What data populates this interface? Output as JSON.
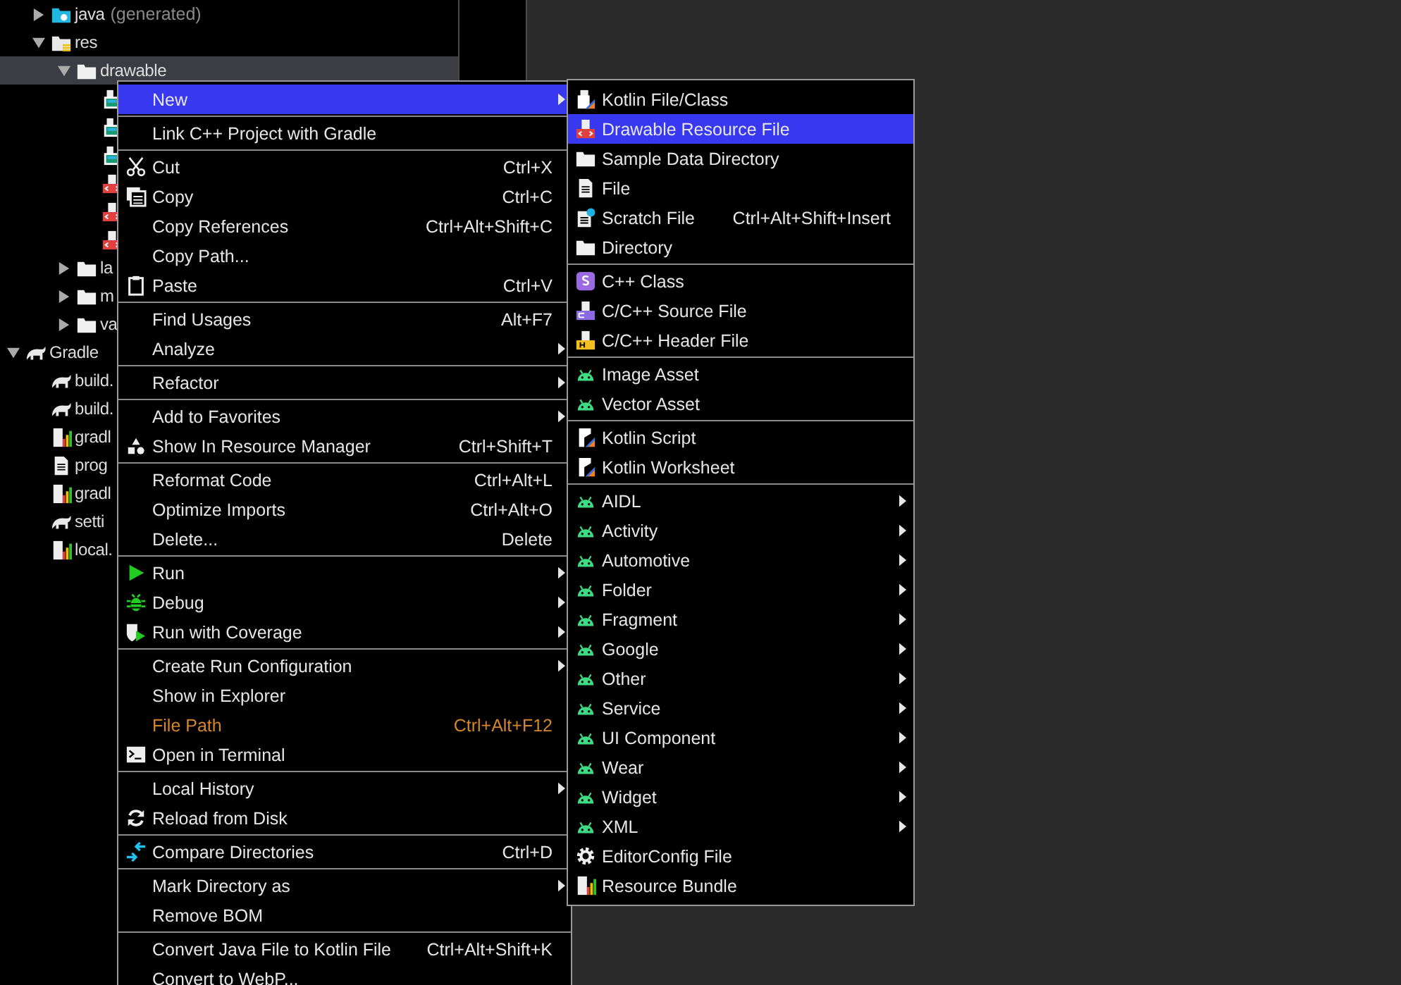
{
  "project_tree": {
    "module_items": [
      {
        "label": "java",
        "note": "(generated)",
        "kind": "java-folder",
        "expanded": false
      },
      {
        "label": "res",
        "kind": "res-folder",
        "expanded": true,
        "selected": false,
        "children": [
          {
            "label": "drawable",
            "kind": "folder",
            "expanded": true,
            "selected": true,
            "children": [
              {
                "kind": "image-file"
              },
              {
                "kind": "image-file"
              },
              {
                "kind": "image-file"
              },
              {
                "kind": "xml-file"
              },
              {
                "kind": "xml-file"
              },
              {
                "kind": "xml-file"
              }
            ]
          },
          {
            "label": "la",
            "kind": "folder",
            "expanded": false,
            "selected": false
          },
          {
            "label": "m",
            "kind": "folder",
            "expanded": false,
            "selected": false
          },
          {
            "label": "va",
            "kind": "folder",
            "expanded": false,
            "selected": false
          }
        ]
      }
    ],
    "root_items": [
      {
        "label": "Gradle",
        "kind": "gradle",
        "expanded": true,
        "children": [
          {
            "label": "build.",
            "kind": "gradle"
          },
          {
            "label": "build.",
            "kind": "gradle"
          },
          {
            "label": "gradl",
            "kind": "properties"
          },
          {
            "label": "prog",
            "kind": "text"
          },
          {
            "label": "gradl",
            "kind": "properties"
          },
          {
            "label": "setti",
            "kind": "gradle"
          },
          {
            "label": "local.",
            "kind": "properties"
          }
        ]
      }
    ]
  },
  "context_menu": {
    "groups": [
      [
        {
          "label": "New",
          "submenu": true,
          "selected": true
        }
      ],
      [
        {
          "label": "Link C++ Project with Gradle",
          "selected": false
        }
      ],
      [
        {
          "label": "Cut",
          "kind": "cut",
          "shortcut": "Ctrl+X",
          "selected": false
        },
        {
          "label": "Copy",
          "kind": "copy",
          "shortcut": "Ctrl+C",
          "selected": false
        },
        {
          "label": "Copy References",
          "shortcut": "Ctrl+Alt+Shift+C",
          "selected": false
        },
        {
          "label": "Copy Path...",
          "selected": false
        },
        {
          "label": "Paste",
          "kind": "paste",
          "shortcut": "Ctrl+V",
          "selected": false
        }
      ],
      [
        {
          "label": "Find Usages",
          "shortcut": "Alt+F7",
          "selected": false
        },
        {
          "label": "Analyze",
          "submenu": true,
          "selected": false
        }
      ],
      [
        {
          "label": "Refactor",
          "submenu": true,
          "selected": false
        }
      ],
      [
        {
          "label": "Add to Favorites",
          "submenu": true,
          "selected": false
        },
        {
          "label": "Show In Resource Manager",
          "kind": "resources",
          "shortcut": "Ctrl+Shift+T",
          "selected": false
        }
      ],
      [
        {
          "label": "Reformat Code",
          "shortcut": "Ctrl+Alt+L",
          "selected": false
        },
        {
          "label": "Optimize Imports",
          "shortcut": "Ctrl+Alt+O",
          "selected": false
        },
        {
          "label": "Delete...",
          "shortcut": "Delete",
          "selected": false
        }
      ],
      [
        {
          "label": "Run",
          "kind": "run",
          "submenu": true,
          "selected": false
        },
        {
          "label": "Debug",
          "kind": "debug",
          "submenu": true,
          "selected": false
        },
        {
          "label": "Run with Coverage",
          "kind": "coverage",
          "submenu": true,
          "selected": false
        }
      ],
      [
        {
          "label": "Create Run Configuration",
          "submenu": true,
          "selected": false
        },
        {
          "label": "Show in Explorer",
          "selected": false
        },
        {
          "label": "File Path",
          "shortcut": "Ctrl+Alt+F12",
          "color": "#d4862a",
          "selected": false
        },
        {
          "label": "Open in Terminal",
          "kind": "terminal",
          "selected": false
        }
      ],
      [
        {
          "label": "Local History",
          "submenu": true,
          "selected": false
        },
        {
          "label": "Reload from Disk",
          "kind": "refresh",
          "selected": false
        }
      ],
      [
        {
          "label": "Compare Directories",
          "kind": "compare",
          "shortcut": "Ctrl+D",
          "selected": false
        }
      ],
      [
        {
          "label": "Mark Directory as",
          "submenu": true,
          "selected": false
        },
        {
          "label": "Remove BOM",
          "selected": false
        }
      ],
      [
        {
          "label": "Convert Java File to Kotlin File",
          "shortcut": "Ctrl+Alt+Shift+K",
          "selected": false
        },
        {
          "label": "Convert to WebP...",
          "selected": false
        }
      ]
    ]
  },
  "new_submenu": {
    "groups": [
      [
        {
          "label": "Kotlin File/Class",
          "kind": "kotlin",
          "selected": false
        },
        {
          "label": "Drawable Resource File",
          "kind": "drawable",
          "selected": true
        },
        {
          "label": "Sample Data Directory",
          "kind": "folder",
          "selected": false
        },
        {
          "label": "File",
          "kind": "file",
          "selected": false
        },
        {
          "label": "Scratch File",
          "kind": "scratch",
          "shortcut": "Ctrl+Alt+Shift+Insert",
          "selected": false
        },
        {
          "label": "Directory",
          "kind": "folder",
          "selected": false
        }
      ],
      [
        {
          "label": "C++ Class",
          "kind": "cppclass",
          "selected": false
        },
        {
          "label": "C/C++ Source File",
          "kind": "csource",
          "selected": false
        },
        {
          "label": "C/C++ Header File",
          "kind": "cheader",
          "selected": false
        }
      ],
      [
        {
          "label": "Image Asset",
          "kind": "android",
          "selected": false
        },
        {
          "label": "Vector Asset",
          "kind": "android",
          "selected": false
        }
      ],
      [
        {
          "label": "Kotlin Script",
          "kind": "kotlinscript",
          "selected": false
        },
        {
          "label": "Kotlin Worksheet",
          "kind": "kotlinscript",
          "selected": false
        }
      ],
      [
        {
          "label": "AIDL",
          "kind": "android",
          "submenu": true,
          "selected": false
        },
        {
          "label": "Activity",
          "kind": "android",
          "submenu": true,
          "selected": false
        },
        {
          "label": "Automotive",
          "kind": "android",
          "submenu": true,
          "selected": false
        },
        {
          "label": "Folder",
          "kind": "android",
          "submenu": true,
          "selected": false
        },
        {
          "label": "Fragment",
          "kind": "android",
          "submenu": true,
          "selected": false
        },
        {
          "label": "Google",
          "kind": "android",
          "submenu": true,
          "selected": false
        },
        {
          "label": "Other",
          "kind": "android",
          "submenu": true,
          "selected": false
        },
        {
          "label": "Service",
          "kind": "android",
          "submenu": true,
          "selected": false
        },
        {
          "label": "UI Component",
          "kind": "android",
          "submenu": true,
          "selected": false
        },
        {
          "label": "Wear",
          "kind": "android",
          "submenu": true,
          "selected": false
        },
        {
          "label": "Widget",
          "kind": "android",
          "submenu": true,
          "selected": false
        },
        {
          "label": "XML",
          "kind": "android",
          "submenu": true,
          "selected": false
        },
        {
          "label": "EditorConfig File",
          "kind": "gear",
          "selected": false
        },
        {
          "label": "Resource Bundle",
          "kind": "properties",
          "selected": false
        }
      ]
    ]
  }
}
